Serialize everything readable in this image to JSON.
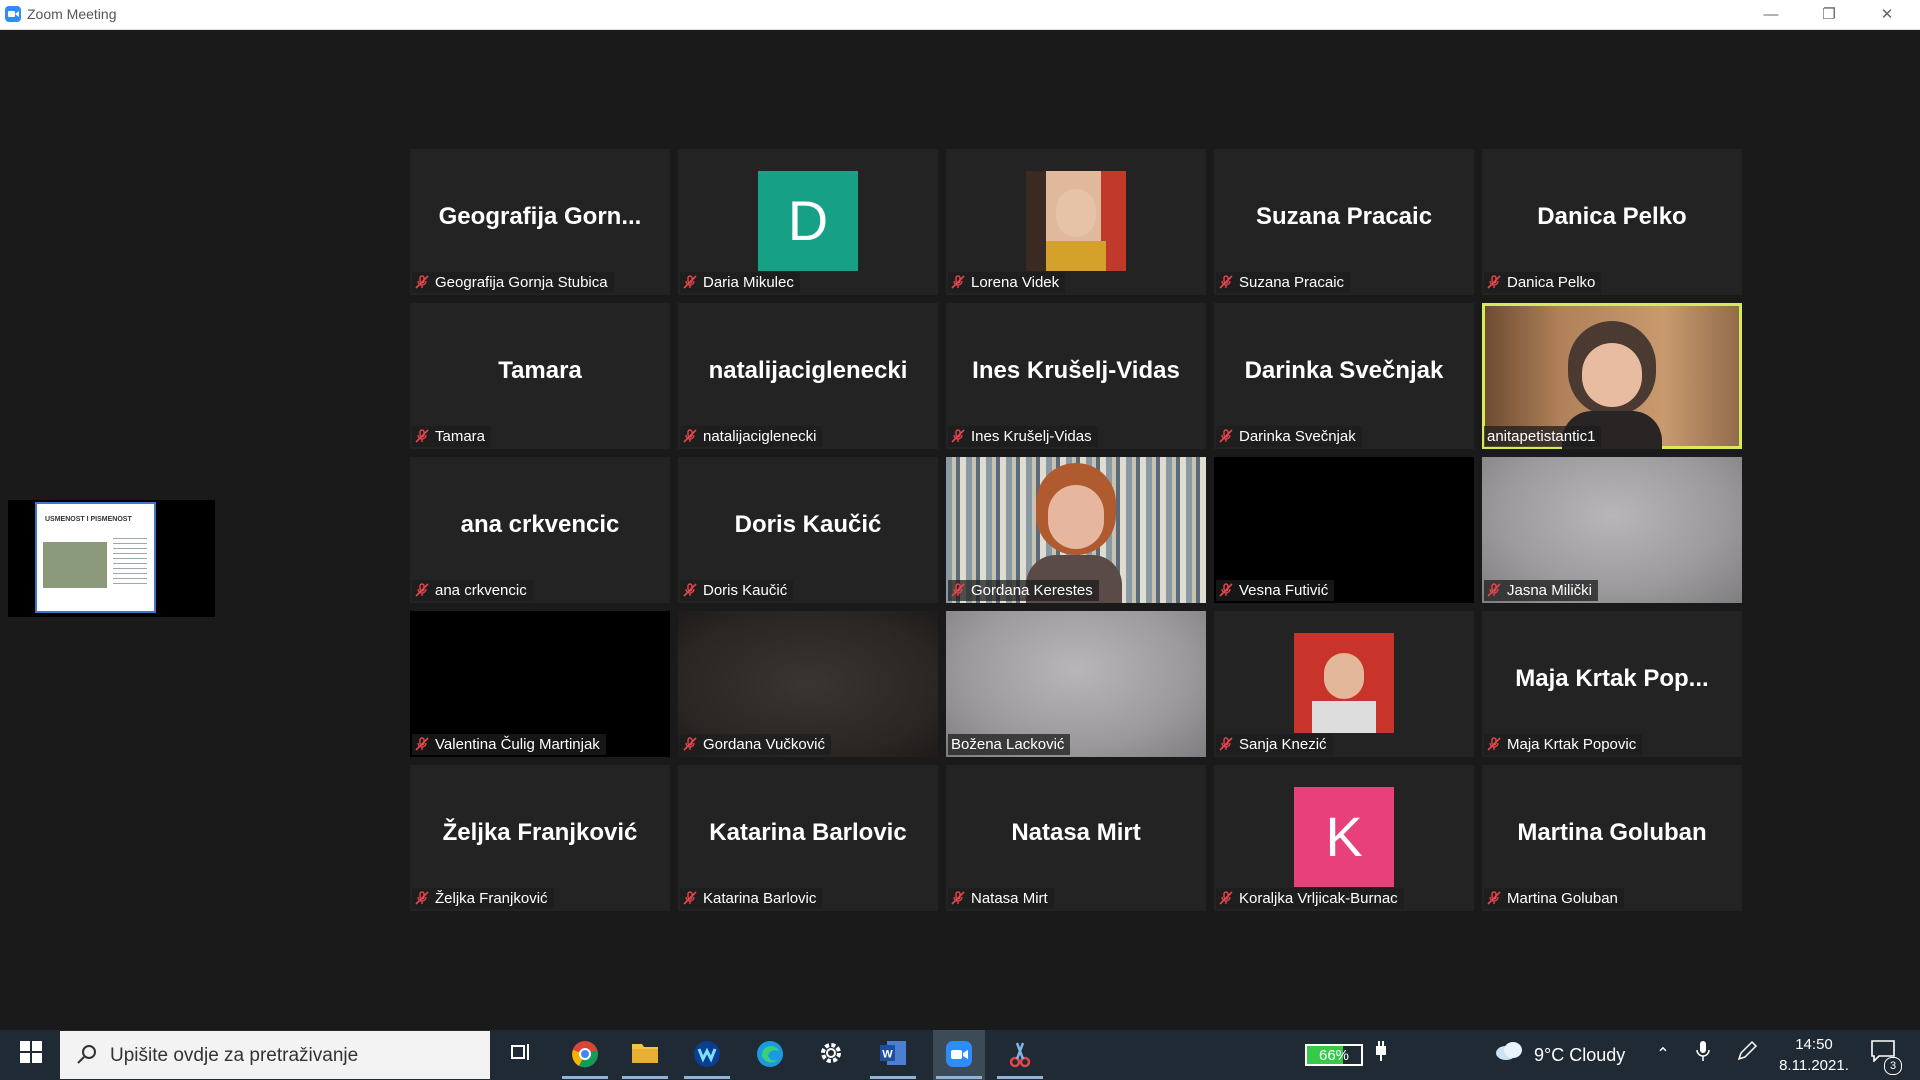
{
  "window": {
    "title": "Zoom Meeting"
  },
  "share_thumbnail": {
    "slide_title": "USMENOST I PISMENOST"
  },
  "participants": [
    {
      "display": "Geografija  Gorn...",
      "name": "Geografija Gornja Stubica",
      "muted": true,
      "kind": "text"
    },
    {
      "display": "D",
      "name": "Daria Mikulec",
      "muted": true,
      "kind": "avatar",
      "avatar_color": "#16a085"
    },
    {
      "display": "",
      "name": "Lorena Videk",
      "muted": true,
      "kind": "photo"
    },
    {
      "display": "Suzana Pracaic",
      "name": "Suzana Pracaic",
      "muted": true,
      "kind": "text"
    },
    {
      "display": "Danica Pelko",
      "name": "Danica Pelko",
      "muted": true,
      "kind": "text"
    },
    {
      "display": "Tamara",
      "name": "Tamara",
      "muted": true,
      "kind": "text"
    },
    {
      "display": "natalijaciglenecki",
      "name": "natalijaciglenecki",
      "muted": true,
      "kind": "text"
    },
    {
      "display": "Ines Krušelj-Vidas",
      "name": "Ines Krušelj-Vidas",
      "muted": true,
      "kind": "text"
    },
    {
      "display": "Darinka Svečnjak",
      "name": "Darinka Svečnjak",
      "muted": true,
      "kind": "text"
    },
    {
      "display": "",
      "name": "anitapetistantic1",
      "muted": false,
      "kind": "video",
      "active": true
    },
    {
      "display": "ana crkvencic",
      "name": "ana crkvencic",
      "muted": true,
      "kind": "text"
    },
    {
      "display": "Doris Kaučić",
      "name": "Doris Kaučić",
      "muted": true,
      "kind": "text"
    },
    {
      "display": "",
      "name": "Gordana Kerestes",
      "muted": true,
      "kind": "video"
    },
    {
      "display": "",
      "name": "Vesna Futivić",
      "muted": true,
      "kind": "black"
    },
    {
      "display": "",
      "name": "Jasna Milički",
      "muted": true,
      "kind": "grey"
    },
    {
      "display": "",
      "name": "Valentina Čulig Martinjak",
      "muted": true,
      "kind": "black"
    },
    {
      "display": "",
      "name": "Gordana Vučković",
      "muted": true,
      "kind": "dark"
    },
    {
      "display": "",
      "name": "Božena Lacković",
      "muted": false,
      "kind": "grey"
    },
    {
      "display": "",
      "name": "Sanja Knezić",
      "muted": true,
      "kind": "photo2"
    },
    {
      "display": "Maja Krtak Pop...",
      "name": "Maja Krtak Popovic",
      "muted": true,
      "kind": "text"
    },
    {
      "display": "Željka Franjković",
      "name": "Željka Franjković",
      "muted": true,
      "kind": "text"
    },
    {
      "display": "Katarina Barlovic",
      "name": "Katarina Barlovic",
      "muted": true,
      "kind": "text"
    },
    {
      "display": "Natasa Mirt",
      "name": "Natasa Mirt",
      "muted": true,
      "kind": "text"
    },
    {
      "display": "K",
      "name": "Koraljka Vrljicak-Burnac",
      "muted": true,
      "kind": "avatar",
      "avatar_color": "#e8407a"
    },
    {
      "display": "Martina Goluban",
      "name": "Martina Goluban",
      "muted": true,
      "kind": "text"
    }
  ],
  "taskbar": {
    "search_placeholder": "Upišite ovdje za pretraživanje",
    "battery": "66%",
    "weather": "9°C  Cloudy",
    "time": "14:50",
    "date": "8.11.2021.",
    "notification_count": "3"
  }
}
